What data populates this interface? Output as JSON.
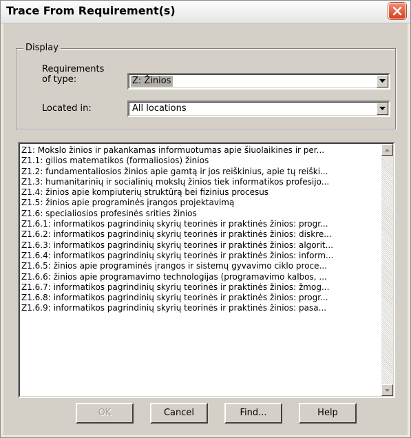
{
  "window": {
    "title": "Trace From Requirement(s)"
  },
  "display_group": {
    "legend": "Display",
    "type_label_line1": "Requirements",
    "type_label_line2": "of type:",
    "type_value": "Z: Žinios",
    "location_label": "Located in:",
    "location_value": "All locations"
  },
  "requirements": [
    "Z1: Mokslo žinios ir pakankamas informuotumas apie šiuolaikines ir per...",
    "Z1.1: gilios matematikos (formaliosios) žinios",
    "Z1.2: fundamentaliosios žinios apie gamtą ir jos reiškinius, apie tų reiški...",
    "Z1.3: humanitarinių ir socialinių mokslų žinios tiek informatikos profesijo...",
    "Z1.4: žinios apie kompiuterių struktūrą bei fizinius procesus",
    "Z1.5: žinios apie programinės įrangos projektavimą",
    "Z1.6: specialiosios profesinės srities žinios",
    "Z1.6.1: informatikos pagrindinių skyrių teorinės ir praktinės žinios: progr...",
    "Z1.6.2: informatikos pagrindinių skyrių teorinės ir praktinės žinios: diskre...",
    "Z1.6.3: informatikos pagrindinių skyrių teorinės ir praktinės žinios: algorit...",
    "Z1.6.4: informatikos pagrindinių skyrių teorinės ir praktinės žinios: inform...",
    "Z1.6.5: žinios apie programinės įrangos ir sistemų gyvavimo ciklo proce...",
    "Z1.6.6: žinios apie programavimo technologijas (programavimo kalbos, ...",
    "Z1.6.7: informatikos pagrindinių skyrių teorinės ir praktinės žinios: žmog...",
    "Z1.6.8: informatikos pagrindinių skyrių teorinės ir praktinės žinios: progr...",
    "Z1.6.9: informatikos pagrindinių skyrių teorinės ir praktinės žinios: pasa..."
  ],
  "buttons": {
    "ok": "OK",
    "cancel": "Cancel",
    "find": "Find...",
    "help": "Help"
  }
}
